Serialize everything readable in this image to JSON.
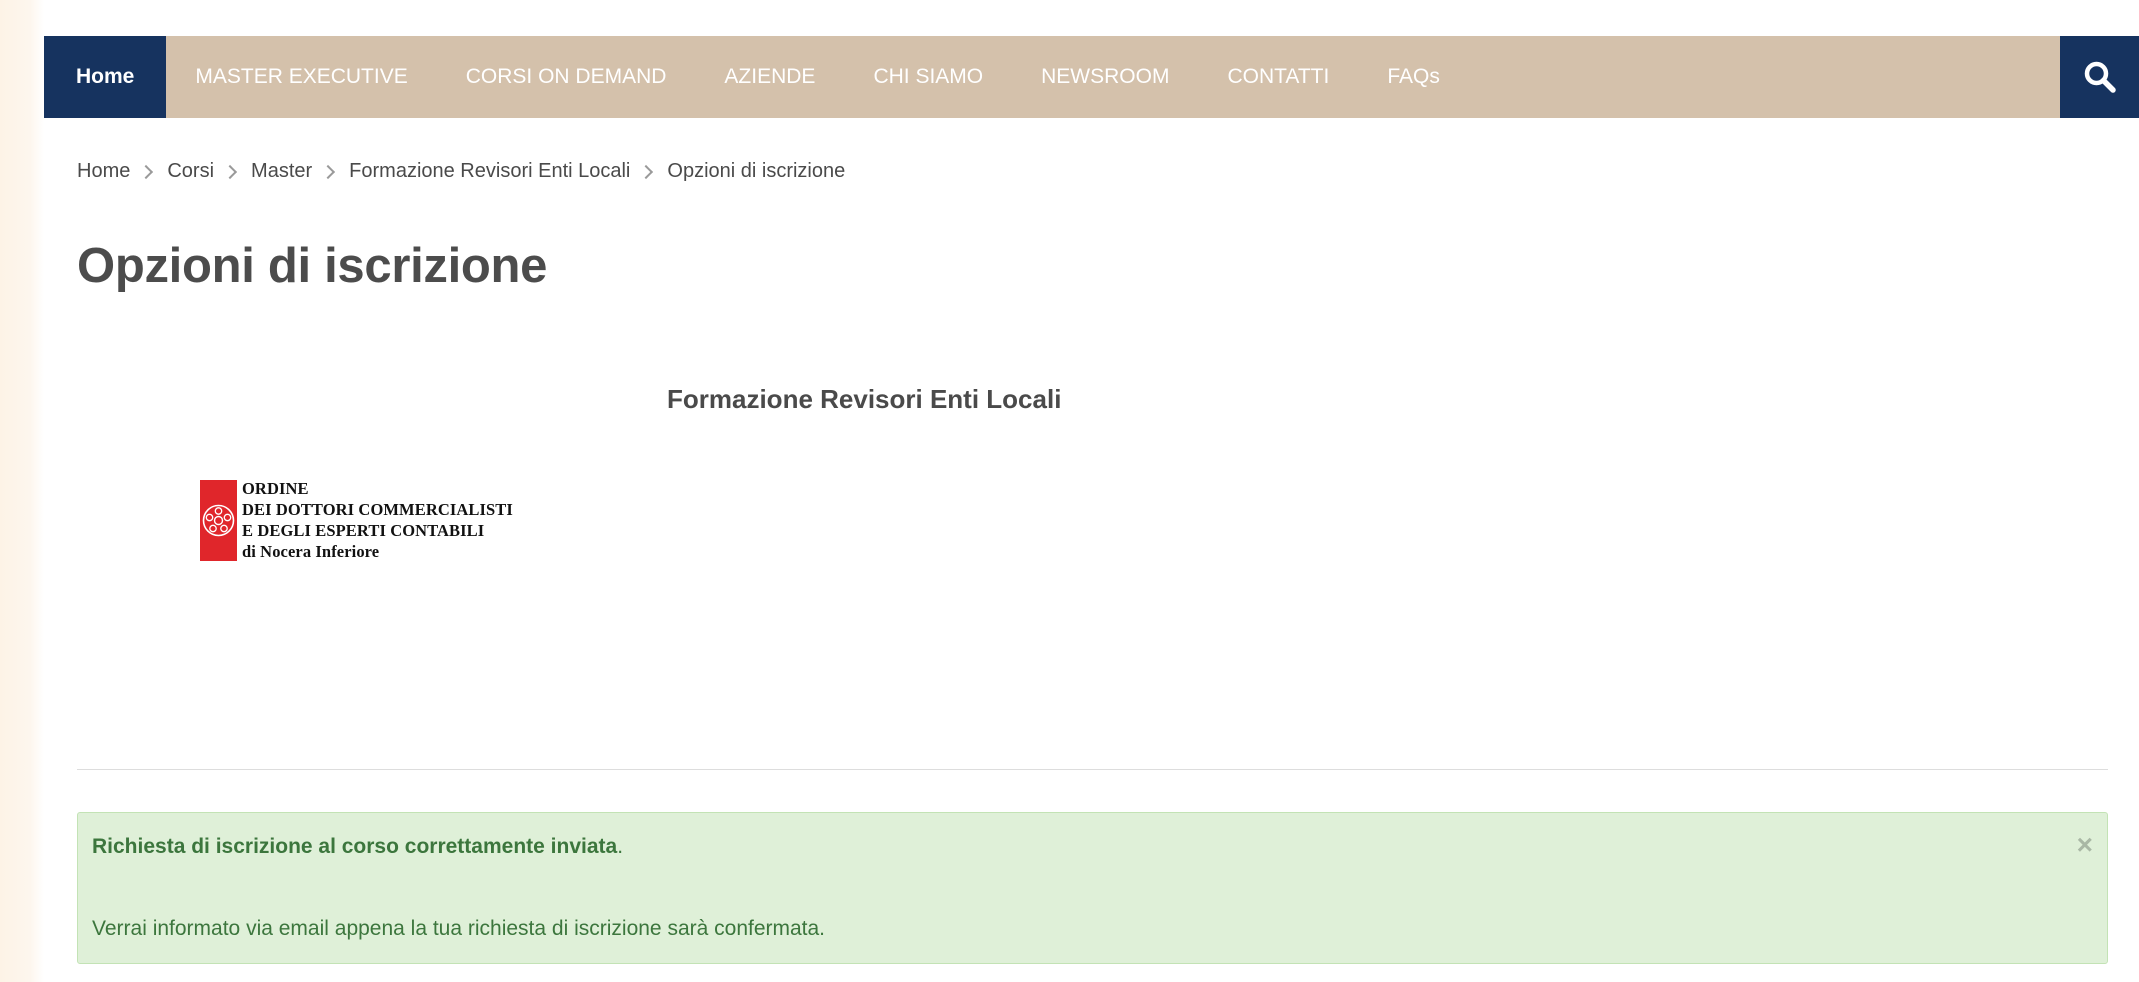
{
  "nav": {
    "items": [
      {
        "label": "Home",
        "active": true
      },
      {
        "label": "MASTER EXECUTIVE"
      },
      {
        "label": "CORSI ON DEMAND"
      },
      {
        "label": "AZIENDE"
      },
      {
        "label": "CHI SIAMO"
      },
      {
        "label": "NEWSROOM"
      },
      {
        "label": "CONTATTI"
      },
      {
        "label": "FAQs"
      }
    ],
    "search_icon": "search-icon"
  },
  "breadcrumb": [
    "Home",
    "Corsi",
    "Master",
    "Formazione Revisori Enti Locali",
    "Opzioni di iscrizione"
  ],
  "page_title": "Opzioni di iscrizione",
  "course": {
    "title": "Formazione Revisori Enti Locali",
    "logo_lines": [
      "ORDINE",
      "DEI DOTTORI COMMERCIALISTI",
      "E DEGLI ESPERTI CONTABILI",
      "di Nocera Inferiore"
    ]
  },
  "alert": {
    "bold_text": "Richiesta di iscrizione al corso correttamente inviata",
    "bold_suffix": ".",
    "message": "Verrai informato via email appena la tua richiesta di iscrizione sarà confermata.",
    "close_label": "×"
  },
  "colors": {
    "nav_bg": "#d4c1ab",
    "nav_active": "#16335f",
    "alert_bg": "#dff0d8",
    "alert_text": "#3c763d",
    "logo_red": "#e0262b"
  }
}
